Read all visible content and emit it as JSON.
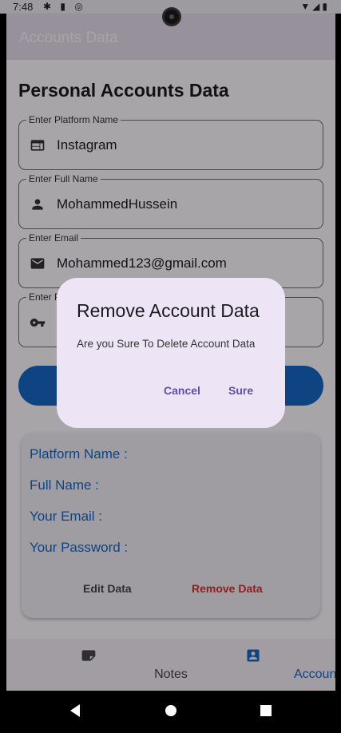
{
  "status_bar": {
    "time": "7:48",
    "left_icons": "✱ ▮ ◎",
    "right_icons": "▼◢▮"
  },
  "app_bar": {
    "title": "Accounts Data"
  },
  "page": {
    "title": "Personal Accounts Data"
  },
  "fields": [
    {
      "label": "Enter Platform Name",
      "value": "Instagram",
      "icon": "web-icon"
    },
    {
      "label": "Enter Full Name",
      "value": "MohammedHussein",
      "icon": "person-icon"
    },
    {
      "label": "Enter Email",
      "value": "Mohammed123@gmail.com",
      "icon": "mail-icon"
    },
    {
      "label": "Enter P",
      "value": "",
      "icon": "key-icon"
    }
  ],
  "card": {
    "platform_label": "Platform Name :",
    "fullname_label": "Full Name :",
    "email_label": "Your Email :",
    "password_label": "Your Password :",
    "edit_button": "Edit Data",
    "remove_button": "Remove Data"
  },
  "bottom_nav": {
    "items": [
      {
        "label": "Notes",
        "icon": "note-icon"
      },
      {
        "label": "Accounts Data",
        "icon": "account-box-icon"
      }
    ]
  },
  "dialog": {
    "title": "Remove Account Data",
    "message": "Are you Sure To Delete Account Data",
    "cancel": "Cancel",
    "confirm": "Sure"
  },
  "colors": {
    "primary": "#1565c0",
    "remove": "#d32f2f",
    "dialog_button": "#5e4fa2"
  }
}
